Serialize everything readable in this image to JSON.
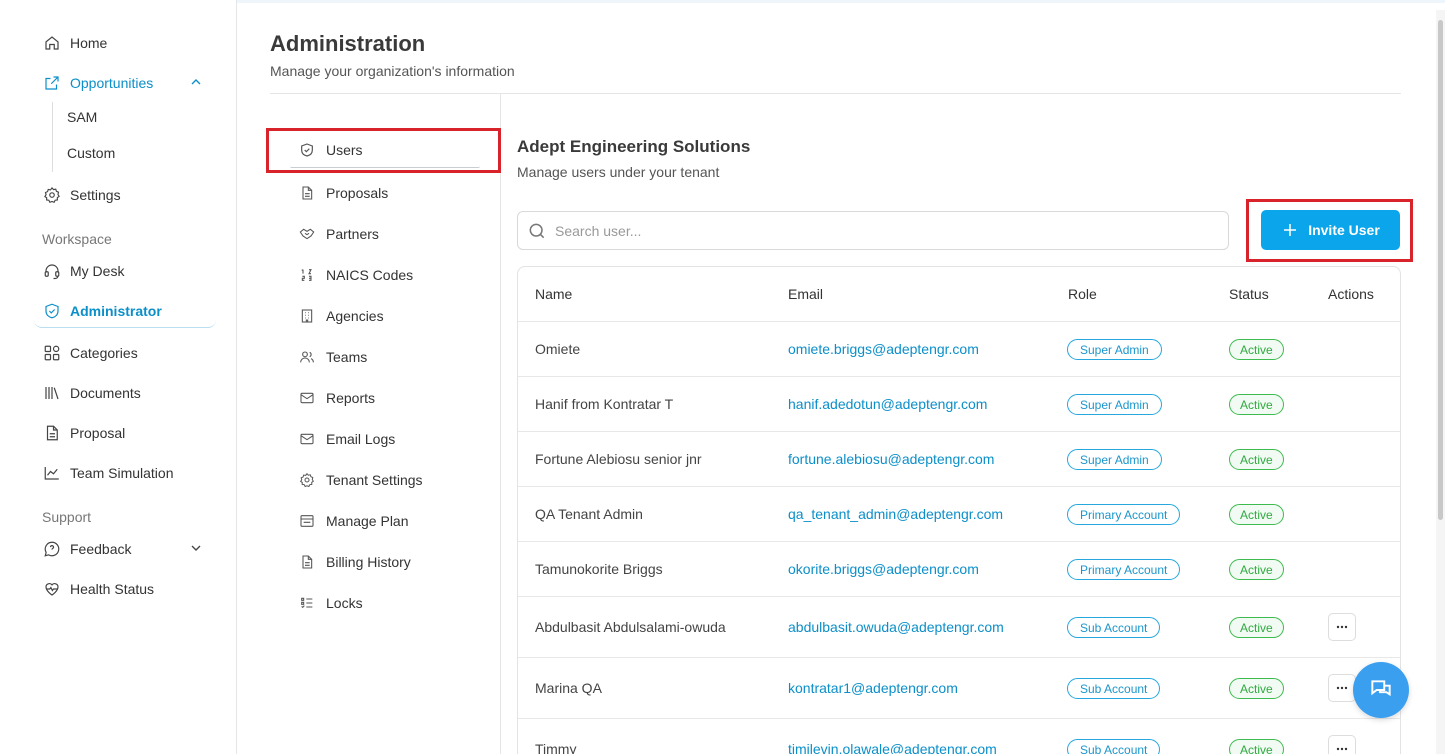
{
  "sidebar": {
    "home": "Home",
    "opportunities": "Opportunities",
    "opportunities_sub": [
      "SAM",
      "Custom"
    ],
    "settings": "Settings",
    "workspace_label": "Workspace",
    "my_desk": "My Desk",
    "administrator": "Administrator",
    "categories": "Categories",
    "documents": "Documents",
    "proposal": "Proposal",
    "team_simulation": "Team Simulation",
    "support_label": "Support",
    "feedback": "Feedback",
    "health_status": "Health Status"
  },
  "header": {
    "title": "Administration",
    "subtitle": "Manage your organization's information"
  },
  "admin_menu": [
    "Users",
    "Proposals",
    "Partners",
    "NAICS Codes",
    "Agencies",
    "Teams",
    "Reports",
    "Email Logs",
    "Tenant Settings",
    "Manage Plan",
    "Billing History",
    "Locks"
  ],
  "content": {
    "org_title": "Adept Engineering Solutions",
    "org_subtitle": "Manage users under your tenant",
    "search_placeholder": "Search user...",
    "invite_label": "Invite User"
  },
  "table": {
    "headers": [
      "Name",
      "Email",
      "Role",
      "Status",
      "Actions"
    ],
    "rows": [
      {
        "name": "Omiete",
        "email": "omiete.briggs@adeptengr.com",
        "role": "Super Admin",
        "status": "Active"
      },
      {
        "name": "Hanif from Kontratar T",
        "email": "hanif.adedotun@adeptengr.com",
        "role": "Super Admin",
        "status": "Active"
      },
      {
        "name": "Fortune Alebiosu senior jnr",
        "email": "fortune.alebiosu@adeptengr.com",
        "role": "Super Admin",
        "status": "Active"
      },
      {
        "name": "QA Tenant Admin",
        "email": "qa_tenant_admin@adeptengr.com",
        "role": "Primary Account",
        "status": "Active"
      },
      {
        "name": "Tamunokorite Briggs",
        "email": "okorite.briggs@adeptengr.com",
        "role": "Primary Account",
        "status": "Active"
      },
      {
        "name": "Abdulbasit Abdulsalami-owuda",
        "email": "abdulbasit.owuda@adeptengr.com",
        "role": "Sub Account",
        "status": "Active"
      },
      {
        "name": "Marina QA",
        "email": "kontratar1@adeptengr.com",
        "role": "Sub Account",
        "status": "Active"
      },
      {
        "name": "Timmy",
        "email": "timilevin.olawale@adeptengr.com",
        "role": "Sub Account",
        "status": "Active"
      }
    ]
  },
  "colors": {
    "accent": "#0ba5ec",
    "highlight_box": "#d8232a",
    "active_status": "#2fa940"
  }
}
